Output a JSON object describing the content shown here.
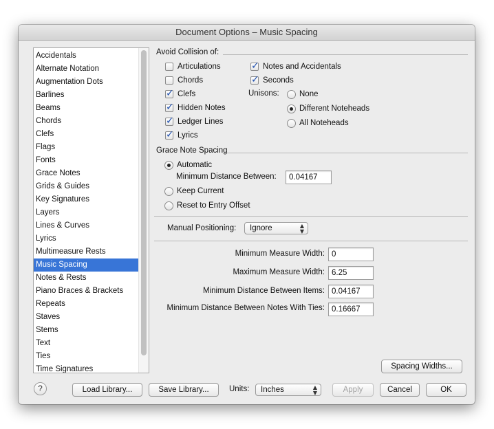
{
  "window": {
    "title": "Document Options – Music Spacing"
  },
  "sidebar": {
    "items": [
      {
        "label": "Accidentals"
      },
      {
        "label": "Alternate Notation"
      },
      {
        "label": "Augmentation Dots"
      },
      {
        "label": "Barlines"
      },
      {
        "label": "Beams"
      },
      {
        "label": "Chords"
      },
      {
        "label": "Clefs"
      },
      {
        "label": "Flags"
      },
      {
        "label": "Fonts"
      },
      {
        "label": "Grace Notes"
      },
      {
        "label": "Grids & Guides"
      },
      {
        "label": "Key Signatures"
      },
      {
        "label": "Layers"
      },
      {
        "label": "Lines & Curves"
      },
      {
        "label": "Lyrics"
      },
      {
        "label": "Multimeasure Rests"
      },
      {
        "label": "Music Spacing",
        "selected": true
      },
      {
        "label": "Notes & Rests"
      },
      {
        "label": "Piano Braces & Brackets"
      },
      {
        "label": "Repeats"
      },
      {
        "label": "Staves"
      },
      {
        "label": "Stems"
      },
      {
        "label": "Text"
      },
      {
        "label": "Ties"
      },
      {
        "label": "Time Signatures"
      }
    ]
  },
  "avoid_collision": {
    "label": "Avoid Collision of:",
    "articulations": {
      "label": "Articulations",
      "checked": false
    },
    "chords": {
      "label": "Chords",
      "checked": false
    },
    "clefs": {
      "label": "Clefs",
      "checked": true
    },
    "hidden_notes": {
      "label": "Hidden Notes",
      "checked": true
    },
    "ledger_lines": {
      "label": "Ledger Lines",
      "checked": true
    },
    "lyrics": {
      "label": "Lyrics",
      "checked": true
    },
    "notes_accidentals": {
      "label": "Notes and Accidentals",
      "checked": true
    },
    "seconds": {
      "label": "Seconds",
      "checked": true
    },
    "unisons_label": "Unisons:",
    "unisons": {
      "none": {
        "label": "None",
        "checked": false
      },
      "different": {
        "label": "Different Noteheads",
        "checked": true
      },
      "all": {
        "label": "All Noteheads",
        "checked": false
      }
    }
  },
  "grace_spacing": {
    "label": "Grace Note Spacing",
    "automatic": {
      "label": "Automatic",
      "checked": true
    },
    "min_distance_label": "Minimum Distance Between:",
    "min_distance_value": "0.04167",
    "keep_current": {
      "label": "Keep Current",
      "checked": false
    },
    "reset_entry": {
      "label": "Reset to Entry Offset",
      "checked": false
    }
  },
  "manual_positioning": {
    "label": "Manual Positioning:",
    "value": "Ignore"
  },
  "measures": {
    "min_width_label": "Minimum Measure Width:",
    "min_width_value": "0",
    "max_width_label": "Maximum Measure Width:",
    "max_width_value": "6.25",
    "min_items_label": "Minimum Distance Between Items:",
    "min_items_value": "0.04167",
    "min_ties_label": "Minimum Distance Between Notes With Ties:",
    "min_ties_value": "0.16667"
  },
  "buttons": {
    "spacing_widths": "Spacing Widths...",
    "help": "?",
    "load_library": "Load Library...",
    "save_library": "Save Library...",
    "apply": "Apply",
    "cancel": "Cancel",
    "ok": "OK"
  },
  "units": {
    "label": "Units:",
    "value": "Inches"
  }
}
